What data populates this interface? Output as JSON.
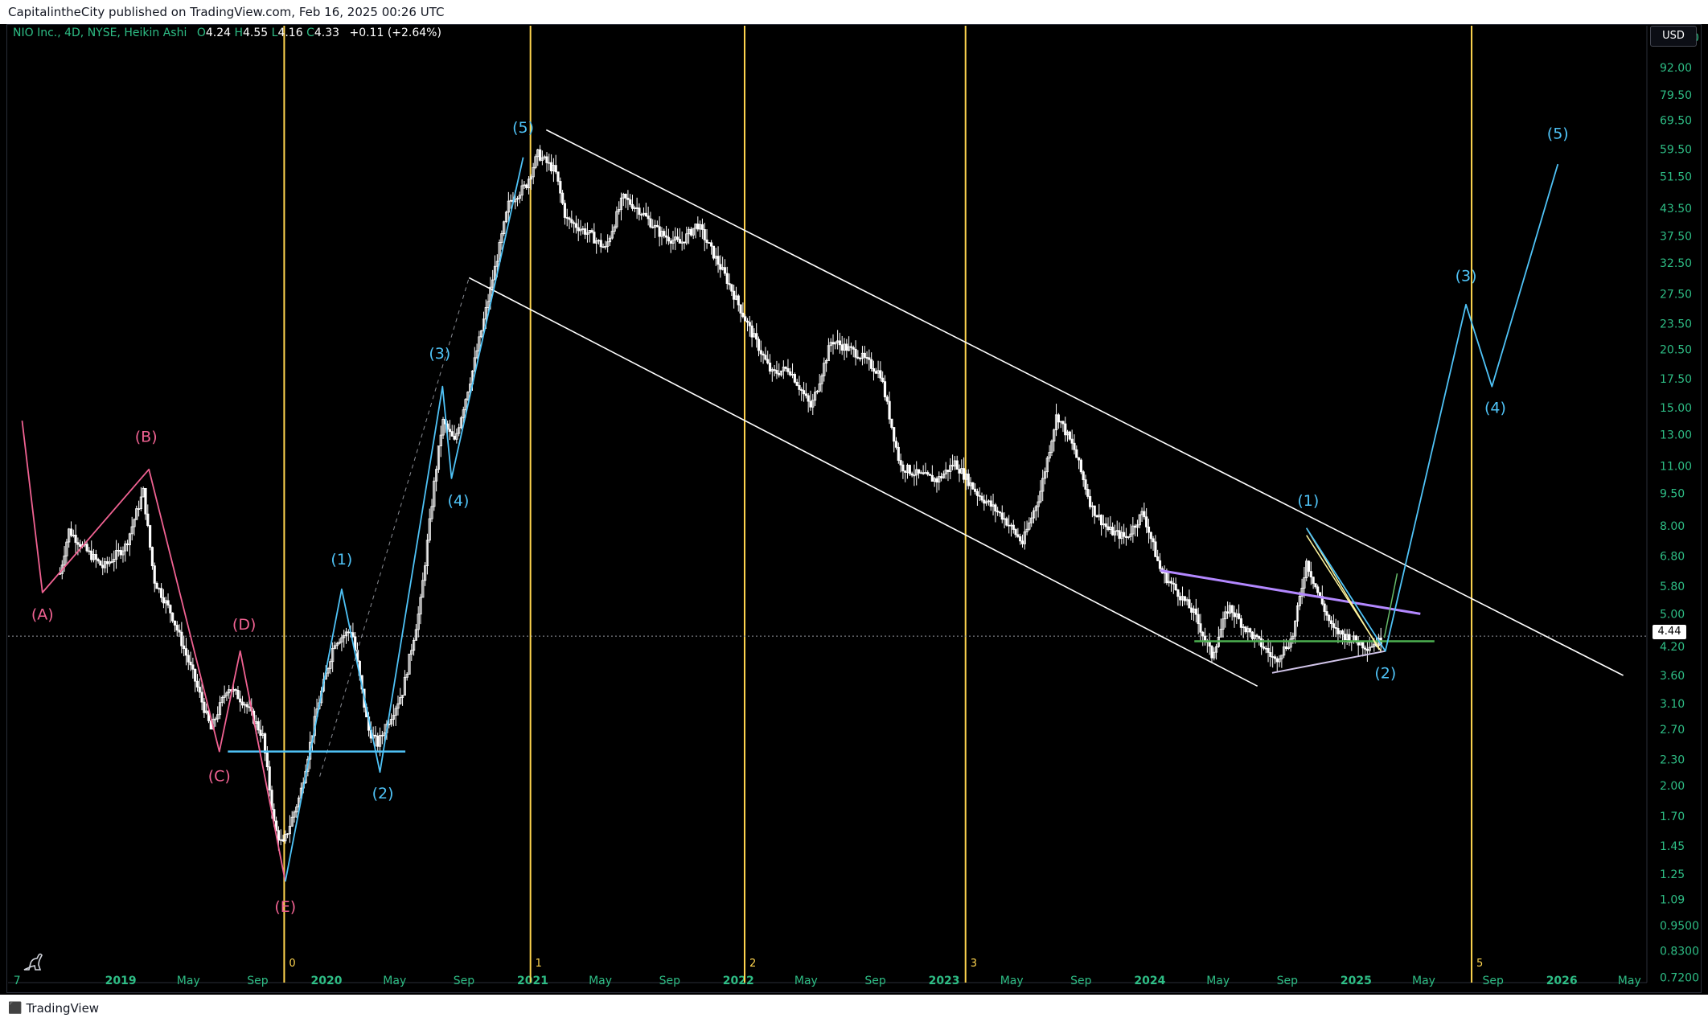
{
  "header": {
    "published_by": "CapitalintheCity published on TradingView.com, Feb 16, 2025 00:26 UTC"
  },
  "legend": {
    "symbol": "NIO Inc., 4D, NYSE, Heikin Ashi",
    "open_label": "O",
    "open": "4.24",
    "high_label": "H",
    "high": "4.55",
    "low_label": "L",
    "low": "4.16",
    "close_label": "C",
    "close": "4.33",
    "change": "+0.11 (+2.64%)"
  },
  "currency_button": "USD",
  "last_price": "4.44",
  "footer": {
    "brand": "TradingView"
  },
  "icons": {
    "bottom_left": "dino-icon",
    "footer": "tradingview-logo-icon"
  },
  "colors": {
    "background": "#000000",
    "candle": "#ffffff",
    "cycle_line": "#ffd54f",
    "wave_cyan": "#4fc3f7",
    "wave_pink": "#f06292",
    "channel": "#ffffff",
    "resistance_purple": "#b388ff",
    "support_green": "#4caf50",
    "axis_text": "#2ebd85"
  },
  "chart_data": {
    "type": "candlestick",
    "chart_style": "Heikin Ashi",
    "symbol": "NIO Inc.",
    "timeframe": "4D",
    "exchange": "NYSE",
    "y_scale": "log",
    "ylim": [
      0.7,
      115
    ],
    "xlim": [
      "2018-06-15",
      "2026-06-01"
    ],
    "y_ticks": [
      "108.00",
      "92.00",
      "79.50",
      "69.50",
      "59.50",
      "51.50",
      "43.50",
      "37.50",
      "32.50",
      "27.50",
      "23.50",
      "20.50",
      "17.50",
      "15.00",
      "13.00",
      "11.00",
      "9.50",
      "8.00",
      "6.80",
      "5.80",
      "5.00",
      "4.20",
      "3.60",
      "3.10",
      "2.70",
      "2.30",
      "2.00",
      "1.70",
      "1.45",
      "1.25",
      "1.09",
      "0.9500",
      "0.8300",
      "0.7200"
    ],
    "x_ticks": [
      {
        "label": "7",
        "date": "2018-07-01"
      },
      {
        "label": "2019",
        "date": "2019-01-01",
        "bold": true
      },
      {
        "label": "May",
        "date": "2019-05-01"
      },
      {
        "label": "Sep",
        "date": "2019-09-01"
      },
      {
        "label": "2020",
        "date": "2020-01-01",
        "bold": true
      },
      {
        "label": "May",
        "date": "2020-05-01"
      },
      {
        "label": "Sep",
        "date": "2020-09-01"
      },
      {
        "label": "2021",
        "date": "2021-01-01",
        "bold": true
      },
      {
        "label": "May",
        "date": "2021-05-01"
      },
      {
        "label": "Sep",
        "date": "2021-09-01"
      },
      {
        "label": "2022",
        "date": "2022-01-01",
        "bold": true
      },
      {
        "label": "May",
        "date": "2022-05-01"
      },
      {
        "label": "Sep",
        "date": "2022-09-01"
      },
      {
        "label": "2023",
        "date": "2023-01-01",
        "bold": true
      },
      {
        "label": "May",
        "date": "2023-05-01"
      },
      {
        "label": "Sep",
        "date": "2023-09-01"
      },
      {
        "label": "2024",
        "date": "2024-01-01",
        "bold": true
      },
      {
        "label": "May",
        "date": "2024-05-01"
      },
      {
        "label": "Sep",
        "date": "2024-09-01"
      },
      {
        "label": "2025",
        "date": "2025-01-01",
        "bold": true
      },
      {
        "label": "May",
        "date": "2025-05-01"
      },
      {
        "label": "Sep",
        "date": "2025-09-01"
      },
      {
        "label": "2026",
        "date": "2026-01-01",
        "bold": true
      },
      {
        "label": "May",
        "date": "2026-05-01"
      }
    ],
    "price_path": [
      [
        "2018-09-15",
        6.2
      ],
      [
        "2018-10-01",
        7.8
      ],
      [
        "2018-11-01",
        7.0
      ],
      [
        "2018-12-01",
        6.4
      ],
      [
        "2019-01-10",
        7.2
      ],
      [
        "2019-02-10",
        9.6
      ],
      [
        "2019-03-01",
        6.0
      ],
      [
        "2019-04-01",
        5.0
      ],
      [
        "2019-05-10",
        3.6
      ],
      [
        "2019-06-10",
        2.7
      ],
      [
        "2019-07-10",
        3.4
      ],
      [
        "2019-08-10",
        3.1
      ],
      [
        "2019-09-10",
        2.6
      ],
      [
        "2019-10-01",
        1.6
      ],
      [
        "2019-10-15",
        1.45
      ],
      [
        "2019-11-15",
        1.9
      ],
      [
        "2019-12-15",
        3.0
      ],
      [
        "2020-01-15",
        4.3
      ],
      [
        "2020-02-15",
        4.6
      ],
      [
        "2020-03-15",
        2.7
      ],
      [
        "2020-04-01",
        2.5
      ],
      [
        "2020-05-15",
        3.3
      ],
      [
        "2020-06-15",
        5.2
      ],
      [
        "2020-07-10",
        10.0
      ],
      [
        "2020-07-25",
        14.0
      ],
      [
        "2020-08-15",
        12.5
      ],
      [
        "2020-09-15",
        18.0
      ],
      [
        "2020-10-15",
        27.0
      ],
      [
        "2020-11-20",
        45.0
      ],
      [
        "2020-12-20",
        49.0
      ],
      [
        "2021-01-10",
        58.0
      ],
      [
        "2021-02-10",
        53.0
      ],
      [
        "2021-03-01",
        41.0
      ],
      [
        "2021-04-10",
        38.0
      ],
      [
        "2021-05-10",
        35.0
      ],
      [
        "2021-06-10",
        46.0
      ],
      [
        "2021-07-10",
        43.0
      ],
      [
        "2021-08-15",
        38.0
      ],
      [
        "2021-09-20",
        36.0
      ],
      [
        "2021-10-20",
        40.0
      ],
      [
        "2021-12-10",
        30.0
      ],
      [
        "2022-01-20",
        23.0
      ],
      [
        "2022-03-01",
        18.0
      ],
      [
        "2022-04-01",
        18.5
      ],
      [
        "2022-05-10",
        15.0
      ],
      [
        "2022-06-15",
        21.5
      ],
      [
        "2022-08-01",
        20.0
      ],
      [
        "2022-09-10",
        18.0
      ],
      [
        "2022-10-15",
        11.0
      ],
      [
        "2022-11-15",
        10.5
      ],
      [
        "2022-12-20",
        10.2
      ],
      [
        "2023-01-20",
        11.2
      ],
      [
        "2023-03-01",
        9.5
      ],
      [
        "2023-04-15",
        8.4
      ],
      [
        "2023-05-20",
        7.3
      ],
      [
        "2023-06-20",
        9.5
      ],
      [
        "2023-07-20",
        14.5
      ],
      [
        "2023-08-20",
        12.0
      ],
      [
        "2023-09-20",
        8.8
      ],
      [
        "2023-10-20",
        7.8
      ],
      [
        "2023-11-20",
        7.5
      ],
      [
        "2023-12-20",
        8.6
      ],
      [
        "2024-01-20",
        6.3
      ],
      [
        "2024-02-20",
        5.6
      ],
      [
        "2024-03-20",
        5.0
      ],
      [
        "2024-04-20",
        4.0
      ],
      [
        "2024-05-20",
        5.2
      ],
      [
        "2024-06-20",
        4.6
      ],
      [
        "2024-07-20",
        4.2
      ],
      [
        "2024-08-10",
        3.9
      ],
      [
        "2024-09-10",
        4.4
      ],
      [
        "2024-10-05",
        6.6
      ],
      [
        "2024-10-25",
        5.6
      ],
      [
        "2024-11-20",
        4.6
      ],
      [
        "2024-12-20",
        4.4
      ],
      [
        "2025-01-20",
        4.2
      ],
      [
        "2025-02-14",
        4.33
      ]
    ],
    "cycle_lines": [
      {
        "label": "0",
        "date": "2019-10-18"
      },
      {
        "label": "1",
        "date": "2020-12-28"
      },
      {
        "label": "2",
        "date": "2022-01-12"
      },
      {
        "label": "3",
        "date": "2023-02-08"
      },
      {
        "label": "5",
        "date": "2025-07-25"
      }
    ],
    "channel": {
      "upper": [
        [
          "2021-01-25",
          66.0
        ],
        [
          "2026-04-20",
          3.6
        ]
      ],
      "lower": [
        [
          "2020-09-10",
          30.0
        ],
        [
          "2024-07-10",
          3.4
        ]
      ]
    },
    "dashed_trend": [
      [
        "2019-12-20",
        2.1
      ],
      [
        "2020-09-10",
        30.0
      ]
    ],
    "horizontal_support": {
      "y": 2.4,
      "from": "2019-07-10",
      "to": "2020-05-20"
    },
    "purple_resistance": [
      [
        "2024-01-20",
        6.3
      ],
      [
        "2025-04-25",
        5.0
      ]
    ],
    "green_support": {
      "y": 4.32,
      "from": "2024-03-20",
      "to": "2025-05-20"
    },
    "lilac_support": [
      [
        "2024-08-05",
        3.65
      ],
      [
        "2025-02-22",
        4.1
      ]
    ],
    "yellow_lines": [
      [
        [
          "2024-10-05",
          7.9
        ],
        [
          "2025-02-10",
          4.15
        ]
      ],
      [
        [
          "2024-10-05",
          7.6
        ],
        [
          "2025-02-14",
          4.1
        ]
      ]
    ],
    "green_arrow": [
      [
        "2025-02-20",
        4.4
      ],
      [
        "2025-03-15",
        6.2
      ]
    ],
    "pink_waves": [
      [
        "2018-07-10",
        14.0
      ],
      [
        "2018-08-15",
        5.6
      ],
      [
        "2019-02-20",
        10.8
      ],
      [
        "2019-06-25",
        2.4
      ],
      [
        "2019-08-01",
        4.1
      ],
      [
        "2019-10-20",
        1.2
      ]
    ],
    "cyan_waves": [
      [
        "2019-10-20",
        1.2
      ],
      [
        "2020-01-28",
        5.7
      ],
      [
        "2020-04-05",
        2.15
      ],
      [
        "2020-07-25",
        16.8
      ],
      [
        "2020-08-10",
        10.3
      ],
      [
        "2020-12-15",
        57.0
      ]
    ],
    "projection": [
      [
        "2024-10-05",
        7.9
      ],
      [
        "2025-02-22",
        4.1
      ],
      [
        "2025-07-15",
        26.0
      ],
      [
        "2025-08-30",
        16.8
      ],
      [
        "2025-12-25",
        55.0
      ]
    ],
    "annotations": [
      {
        "text": "(A)",
        "date": "2018-08-15",
        "price": 4.85,
        "color": "pink"
      },
      {
        "text": "(B)",
        "date": "2019-02-15",
        "price": 12.5,
        "color": "pink"
      },
      {
        "text": "(C)",
        "date": "2019-06-25",
        "price": 2.05,
        "color": "pink"
      },
      {
        "text": "(D)",
        "date": "2019-08-08",
        "price": 4.6,
        "color": "pink"
      },
      {
        "text": "(E)",
        "date": "2019-10-20",
        "price": 1.02,
        "color": "pink"
      },
      {
        "text": "(1)",
        "date": "2020-01-28",
        "price": 6.5,
        "color": "cyan"
      },
      {
        "text": "(2)",
        "date": "2020-04-10",
        "price": 1.87,
        "color": "cyan"
      },
      {
        "text": "(3)",
        "date": "2020-07-20",
        "price": 19.5,
        "color": "cyan"
      },
      {
        "text": "(4)",
        "date": "2020-08-22",
        "price": 8.9,
        "color": "cyan"
      },
      {
        "text": "(5)",
        "date": "2020-12-15",
        "price": 65.0,
        "color": "cyan"
      },
      {
        "text": "(1)",
        "date": "2024-10-08",
        "price": 8.9,
        "color": "cyan"
      },
      {
        "text": "(2)",
        "date": "2025-02-22",
        "price": 3.55,
        "color": "cyan"
      },
      {
        "text": "(3)",
        "date": "2025-07-15",
        "price": 29.5,
        "color": "cyan"
      },
      {
        "text": "(4)",
        "date": "2025-09-05",
        "price": 14.6,
        "color": "cyan"
      },
      {
        "text": "(5)",
        "date": "2025-12-25",
        "price": 63.0,
        "color": "cyan"
      }
    ]
  }
}
